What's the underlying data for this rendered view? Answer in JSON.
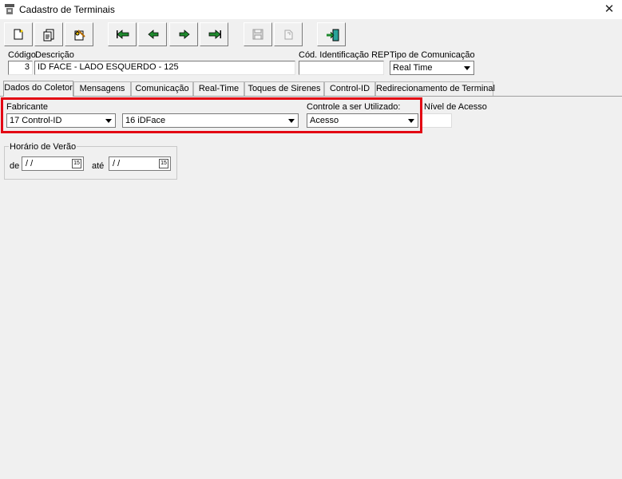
{
  "window": {
    "title": "Cadastro de Terminais",
    "close_symbol": "✕"
  },
  "toolbar": {
    "buttons": [
      {
        "name": "new-button",
        "icon": "new-document-icon"
      },
      {
        "name": "edit-button",
        "icon": "edit-document-icon"
      },
      {
        "name": "tools-button",
        "icon": "tools-icon"
      },
      {
        "name": "first-button",
        "icon": "first-arrow-icon"
      },
      {
        "name": "prev-button",
        "icon": "prev-arrow-icon"
      },
      {
        "name": "next-button",
        "icon": "next-arrow-icon"
      },
      {
        "name": "last-button",
        "icon": "last-arrow-icon"
      },
      {
        "name": "save-button",
        "icon": "save-icon",
        "disabled": true
      },
      {
        "name": "cancel-button",
        "icon": "undo-icon",
        "disabled": true
      },
      {
        "name": "exit-button",
        "icon": "exit-door-icon"
      }
    ]
  },
  "header": {
    "codigo_label": "Código",
    "codigo_value": "3",
    "descricao_label": "Descrição",
    "descricao_value": "ID FACE - LADO ESQUERDO - 125",
    "cod_rep_label": "Cód. Identificação REP",
    "cod_rep_value": "",
    "tipo_com_label": "Tipo de Comunicação",
    "tipo_com_value": "Real Time"
  },
  "tabs": [
    {
      "label": "Dados do Coletor",
      "active": true
    },
    {
      "label": "Mensagens"
    },
    {
      "label": "Comunicação"
    },
    {
      "label": "Real-Time"
    },
    {
      "label": "Toques de Sirenes"
    },
    {
      "label": "Control-ID"
    },
    {
      "label": "Redirecionamento de Terminal"
    }
  ],
  "coletor": {
    "fabricante_label": "Fabricante",
    "fabricante_value": "17 Control-ID",
    "modelo_value": "16 iDFace",
    "controle_label": "Controle a ser Utilizado:",
    "controle_value": "Acesso",
    "nivel_label": "Nível de Acesso",
    "nivel_value": ""
  },
  "horario_verao": {
    "group_label": "Horário de Verão",
    "de_label": "de",
    "de_value": "/ /",
    "ate_label": "até",
    "ate_value": "/ /",
    "calendar_glyph": "15"
  },
  "colors": {
    "highlight": "#e30613",
    "arrow_green": "#1f8a2e"
  }
}
